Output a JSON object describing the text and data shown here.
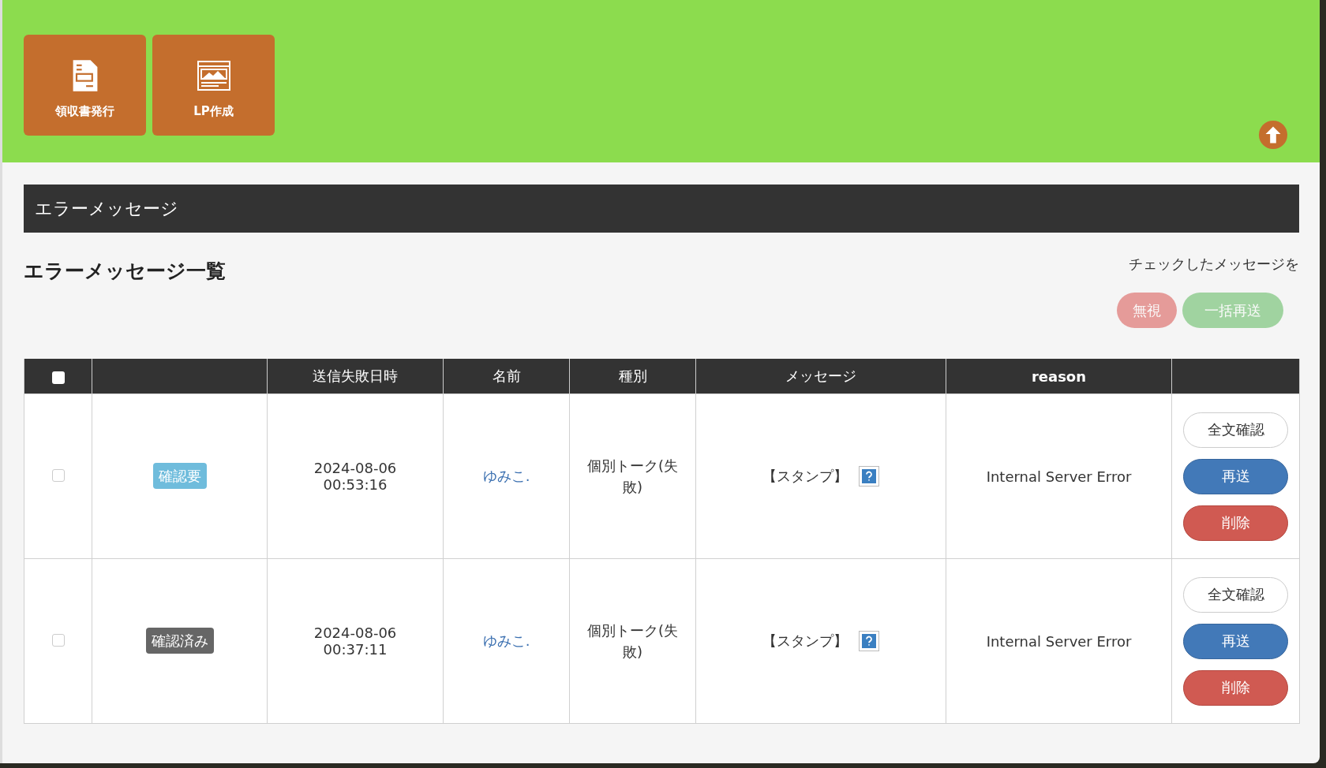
{
  "header": {
    "tiles": [
      {
        "label": "領収書発行",
        "kind": "receipt"
      },
      {
        "label": "LP作成",
        "kind": "webpage"
      }
    ]
  },
  "section_title": "エラーメッセージ",
  "list_title": "エラーメッセージ一覧",
  "bulk": {
    "caption": "チェックしたメッセージを",
    "buttons": [
      {
        "label": "無視",
        "kind": "ignore",
        "disabled": true
      },
      {
        "label": "一括再送",
        "kind": "resend",
        "disabled": true
      }
    ]
  },
  "table": {
    "select_all_checked": false,
    "columns": [
      "",
      "送信失敗日時",
      "名前",
      "種別",
      "メッセージ",
      "reason",
      ""
    ],
    "rows": [
      {
        "checked": false,
        "status": {
          "label": "確認要",
          "color": "#6fbcdc"
        },
        "date": "2024-08-06",
        "time": "00:53:16",
        "name": "ゆみこ.",
        "type": "個別トーク(失敗)",
        "message": "【スタンプ】",
        "reason": "Internal Server Error",
        "actions": [
          "全文確認",
          "再送",
          "削除"
        ]
      },
      {
        "checked": false,
        "status": {
          "label": "確認済み",
          "color": "#666666"
        },
        "date": "2024-08-06",
        "time": "00:37:11",
        "name": "ゆみこ.",
        "type": "個別トーク(失敗)",
        "message": "【スタンプ】",
        "reason": "Internal Server Error",
        "actions": [
          "全文確認",
          "再送",
          "削除"
        ]
      }
    ]
  }
}
